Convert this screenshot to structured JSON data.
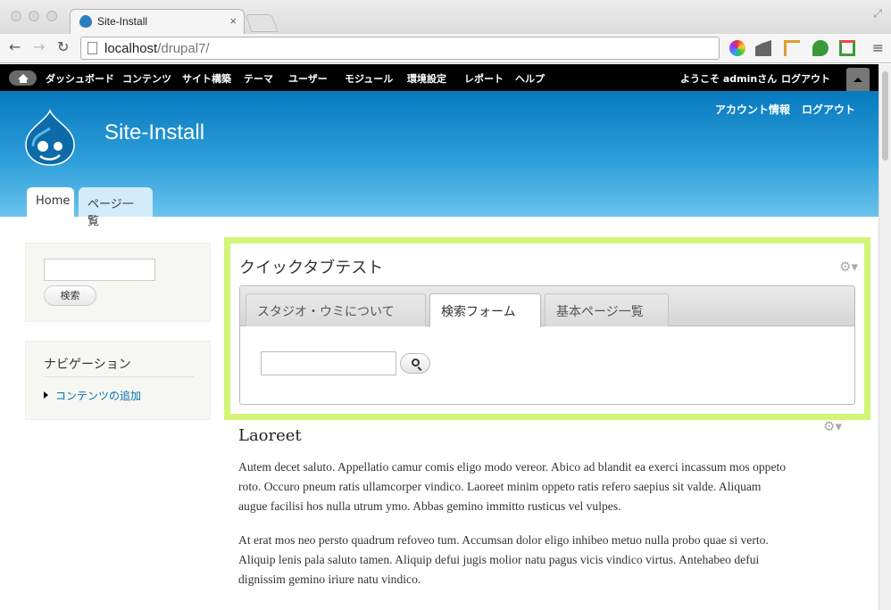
{
  "browser": {
    "tab_title": "Site-Install",
    "tab_close": "×",
    "url_host": "localhost",
    "url_path": "/drupal7/",
    "back_glyph": "←",
    "forward_glyph": "→",
    "reload_glyph": "↻",
    "menu_glyph": "≡",
    "fullscreen_glyph": "⤢"
  },
  "admin_toolbar": {
    "items": [
      "ダッシュボード",
      "コンテンツ",
      "サイト構築",
      "テーマ",
      "ユーザー",
      "モジュール",
      "環境設定",
      "レポート",
      "ヘルプ"
    ],
    "welcome": "ようこそ adminさん",
    "logout": "ログアウト"
  },
  "header": {
    "site_name": "Site-Install",
    "secondary_menu": [
      "アカウント情報",
      "ログアウト"
    ],
    "tabs": [
      "Home",
      "ページ一覧"
    ]
  },
  "sidebar": {
    "search_button": "検索",
    "nav_title": "ナビゲーション",
    "nav_link": "コンテンツの追加"
  },
  "quicktabs": {
    "title": "クイックタブテスト",
    "tabs": [
      "スタジオ・ウミについて",
      "検索フォーム",
      "基本ページ一覧"
    ],
    "active_tab": "検索フォーム"
  },
  "article": {
    "title": "Laoreet",
    "paragraphs": [
      [
        "Autem decet saluto. Appellatio camur comis eligo modo vereor. Abico ad blandit ea exerci incassum mos oppeto",
        "roto. Occuro pneum ratis ullamcorper vindico. Laoreet minim oppeto ratis refero saepius sit valde. Aliquam",
        "augue facilisi hos nulla utrum ymo. Abbas gemino immitto rusticus vel vulpes."
      ],
      [
        "At erat mos neo persto quadrum refoveo tum. Accumsan dolor eligo inhibeo metuo nulla probo quae si verto.",
        "Aliquip lenis pala saluto tamen. Aliquip defui jugis molior natu pagus vicis vindico virtus. Antehabeo defui",
        "dignissim gemino iriure natu vindico."
      ]
    ]
  },
  "colors": {
    "admin_bar": "#000000",
    "header_top": "#0779bf",
    "header_bottom": "#6ac3ee",
    "highlight_border": "#d2f578",
    "link": "#0071b3"
  },
  "icons": [
    "drupal-favicon-icon",
    "home-icon",
    "gear-icon",
    "search-icon",
    "drupal-logo-icon"
  ]
}
